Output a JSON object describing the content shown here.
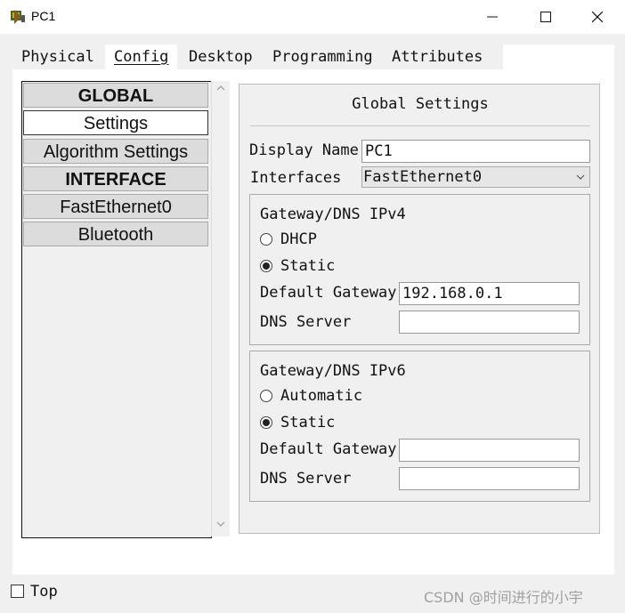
{
  "window": {
    "title": "PC1",
    "icon": "pc-app-icon",
    "minimize": "─",
    "maximize": "☐",
    "close": "✕"
  },
  "tabs": [
    {
      "label": "Physical",
      "active": false
    },
    {
      "label": "Config",
      "active": true
    },
    {
      "label": "Desktop",
      "active": false
    },
    {
      "label": "Programming",
      "active": false
    },
    {
      "label": "Attributes",
      "active": false
    }
  ],
  "sidebar": {
    "items": [
      {
        "label": "GLOBAL",
        "type": "header"
      },
      {
        "label": "Settings",
        "type": "item",
        "selected": true
      },
      {
        "label": "Algorithm Settings",
        "type": "item"
      },
      {
        "label": "INTERFACE",
        "type": "header"
      },
      {
        "label": "FastEthernet0",
        "type": "item"
      },
      {
        "label": "Bluetooth",
        "type": "item"
      }
    ],
    "scroll_up": "^",
    "scroll_down": "v"
  },
  "panel": {
    "title": "Global Settings",
    "display_name_label": "Display Name",
    "display_name_value": "PC1",
    "interfaces_label": "Interfaces",
    "interfaces_value": "FastEthernet0",
    "ipv4": {
      "title": "Gateway/DNS IPv4",
      "option1": "DHCP",
      "option2": "Static",
      "selected": "Static",
      "gateway_label": "Default Gateway",
      "gateway_value": "192.168.0.1",
      "dns_label": "DNS Server",
      "dns_value": ""
    },
    "ipv6": {
      "title": "Gateway/DNS IPv6",
      "option1": "Automatic",
      "option2": "Static",
      "selected": "Static",
      "gateway_label": "Default Gateway",
      "gateway_value": "",
      "dns_label": "DNS Server",
      "dns_value": ""
    }
  },
  "footer": {
    "top_label": "Top",
    "top_checked": false,
    "watermark": "CSDN @时间进行的小宇"
  },
  "colors": {
    "background": "#f0f0f0",
    "active_tab_underline": "#1a3d7a",
    "content": "#ffffff"
  }
}
